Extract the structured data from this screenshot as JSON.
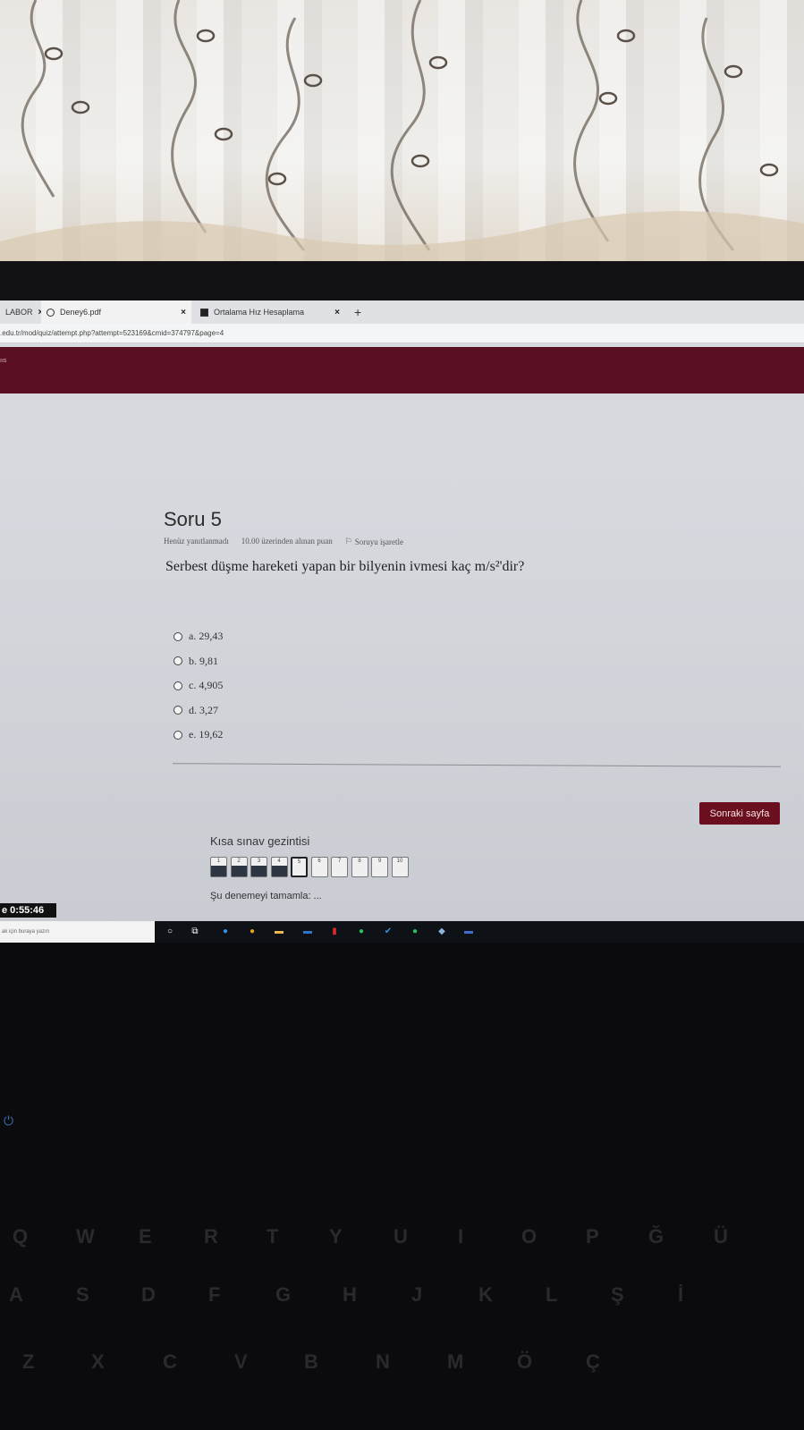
{
  "browser": {
    "tabs": [
      {
        "label": "LABOR",
        "icon": "page-icon"
      },
      {
        "label": "Deney6.pdf",
        "icon": "globe-icon"
      },
      {
        "label": "Ortalama Hız Hesaplama",
        "icon": "app-icon"
      }
    ],
    "tab_close": "×",
    "new_tab": "+",
    "url": ".edu.tr/mod/quiz/attempt.php?attempt=523169&cmid=374797&page=4"
  },
  "site_nav": {
    "label": "ııs",
    "color": "#5a0f23"
  },
  "question": {
    "title": "Soru 5",
    "status": "Henüz yanıtlanmadı",
    "points": "10.00 üzerinden alınan puan",
    "flag_label": "Soruyu işaretle",
    "text": "Serbest düşme hareketi yapan bir bilyenin ivmesi kaç m/s²'dir?",
    "answers": [
      {
        "label": "a. 29,43",
        "selected": false
      },
      {
        "label": "b. 9,81",
        "selected": false
      },
      {
        "label": "c. 4,905",
        "selected": false
      },
      {
        "label": "d. 3,27",
        "selected": false
      },
      {
        "label": "e. 19,62",
        "selected": false
      }
    ]
  },
  "next_button": {
    "label": "Sonraki sayfa",
    "color": "#6b0f1e"
  },
  "quiz_nav": {
    "title": "Kısa sınav gezintisi",
    "items": [
      {
        "n": "1",
        "state": "done"
      },
      {
        "n": "2",
        "state": "done"
      },
      {
        "n": "3",
        "state": "done"
      },
      {
        "n": "4",
        "state": "done"
      },
      {
        "n": "5",
        "state": "current"
      },
      {
        "n": "6",
        "state": "empty"
      },
      {
        "n": "7",
        "state": "empty"
      },
      {
        "n": "8",
        "state": "empty"
      },
      {
        "n": "9",
        "state": "empty"
      },
      {
        "n": "10",
        "state": "empty"
      }
    ],
    "finish": "Şu denemeyi tamamla: ..."
  },
  "timer": "e 0:55:46",
  "taskbar": {
    "search_placeholder": "ak için buraya yazın"
  },
  "keyboard": {
    "row1": [
      "Q",
      "W",
      "E",
      "R",
      "T",
      "Y",
      "U",
      "I",
      "O",
      "P",
      "Ğ",
      "Ü"
    ],
    "row2": [
      "A",
      "S",
      "D",
      "F",
      "G",
      "H",
      "J",
      "K",
      "L",
      "Ş",
      "İ"
    ],
    "row3": [
      "Z",
      "X",
      "C",
      "V",
      "B",
      "N",
      "M",
      "Ö",
      "Ç"
    ]
  }
}
